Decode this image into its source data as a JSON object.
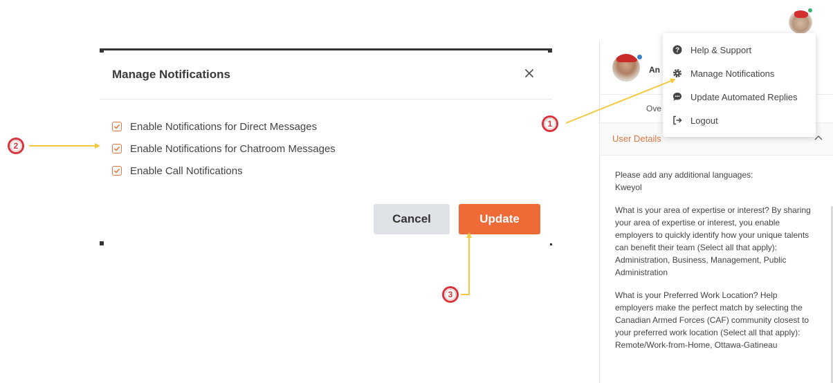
{
  "modal": {
    "title": "Manage Notifications",
    "close_icon": "close-icon",
    "options": [
      {
        "label": "Enable Notifications for Direct Messages",
        "checked": true
      },
      {
        "label": "Enable Notifications for Chatroom Messages",
        "checked": true
      },
      {
        "label": "Enable Call Notifications",
        "checked": true
      }
    ],
    "cancel_label": "Cancel",
    "update_label": "Update"
  },
  "profile_panel": {
    "name": "An",
    "tab_label": "Ove",
    "section_title": "User Details",
    "details": [
      {
        "question": "Please add any additional languages:",
        "answer": "Kweyol"
      },
      {
        "question": "What is your area of expertise or interest? By sharing your area of expertise or interest, you enable employers to quickly identify how your unique talents can benefit their team (Select all that apply):",
        "answer": "Administration, Business, Management, Public Administration"
      },
      {
        "question": "What is your Preferred Work Location? Help employers make the perfect match by selecting the Canadian Armed Forces (CAF) community closest to your preferred work location (Select all that apply):",
        "answer": "Remote/Work-from-Home, Ottawa-Gatineau"
      }
    ]
  },
  "user_menu": {
    "items": [
      {
        "label": "Help & Support",
        "icon": "help-icon"
      },
      {
        "label": "Manage Notifications",
        "icon": "gear-icon"
      },
      {
        "label": "Update Automated Replies",
        "icon": "chat-icon"
      },
      {
        "label": "Logout",
        "icon": "logout-icon"
      }
    ]
  },
  "annotations": {
    "markers": [
      "1",
      "2",
      "3"
    ]
  },
  "colors": {
    "accent": "#ee6a37",
    "checkbox": "#e2743f",
    "arrow": "#f5c842",
    "marker": "#d9343b",
    "cancel_bg": "#dfe3e8"
  }
}
